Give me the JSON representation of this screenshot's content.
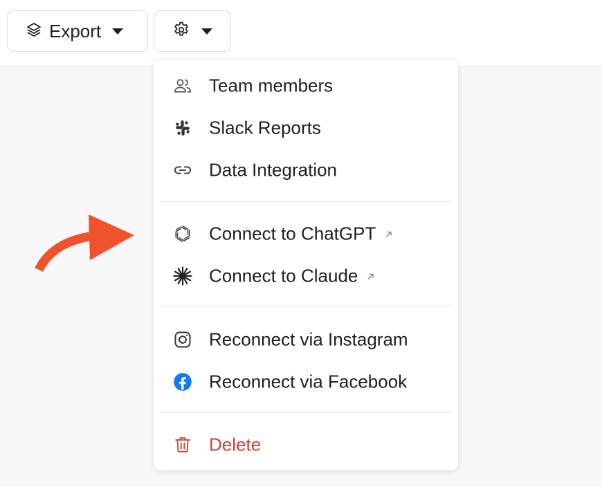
{
  "toolbar": {
    "export_label": "Export",
    "export_icon": "layers-icon",
    "settings_icon": "gear-icon"
  },
  "menu": {
    "items": [
      {
        "label": "Team members",
        "icon": "users-icon"
      },
      {
        "label": "Slack Reports",
        "icon": "slack-icon"
      },
      {
        "label": "Data Integration",
        "icon": "link-icon"
      },
      {
        "label": "Connect to ChatGPT",
        "icon": "chatgpt-icon",
        "external": true
      },
      {
        "label": "Connect to Claude",
        "icon": "claude-icon",
        "external": true
      },
      {
        "label": "Reconnect via Instagram",
        "icon": "instagram-icon"
      },
      {
        "label": "Reconnect via Facebook",
        "icon": "facebook-icon"
      },
      {
        "label": "Delete",
        "icon": "trash-icon"
      }
    ]
  },
  "colors": {
    "delete": "#d43f33",
    "facebook": "#1877f2",
    "annotation_arrow": "#f0522d"
  }
}
